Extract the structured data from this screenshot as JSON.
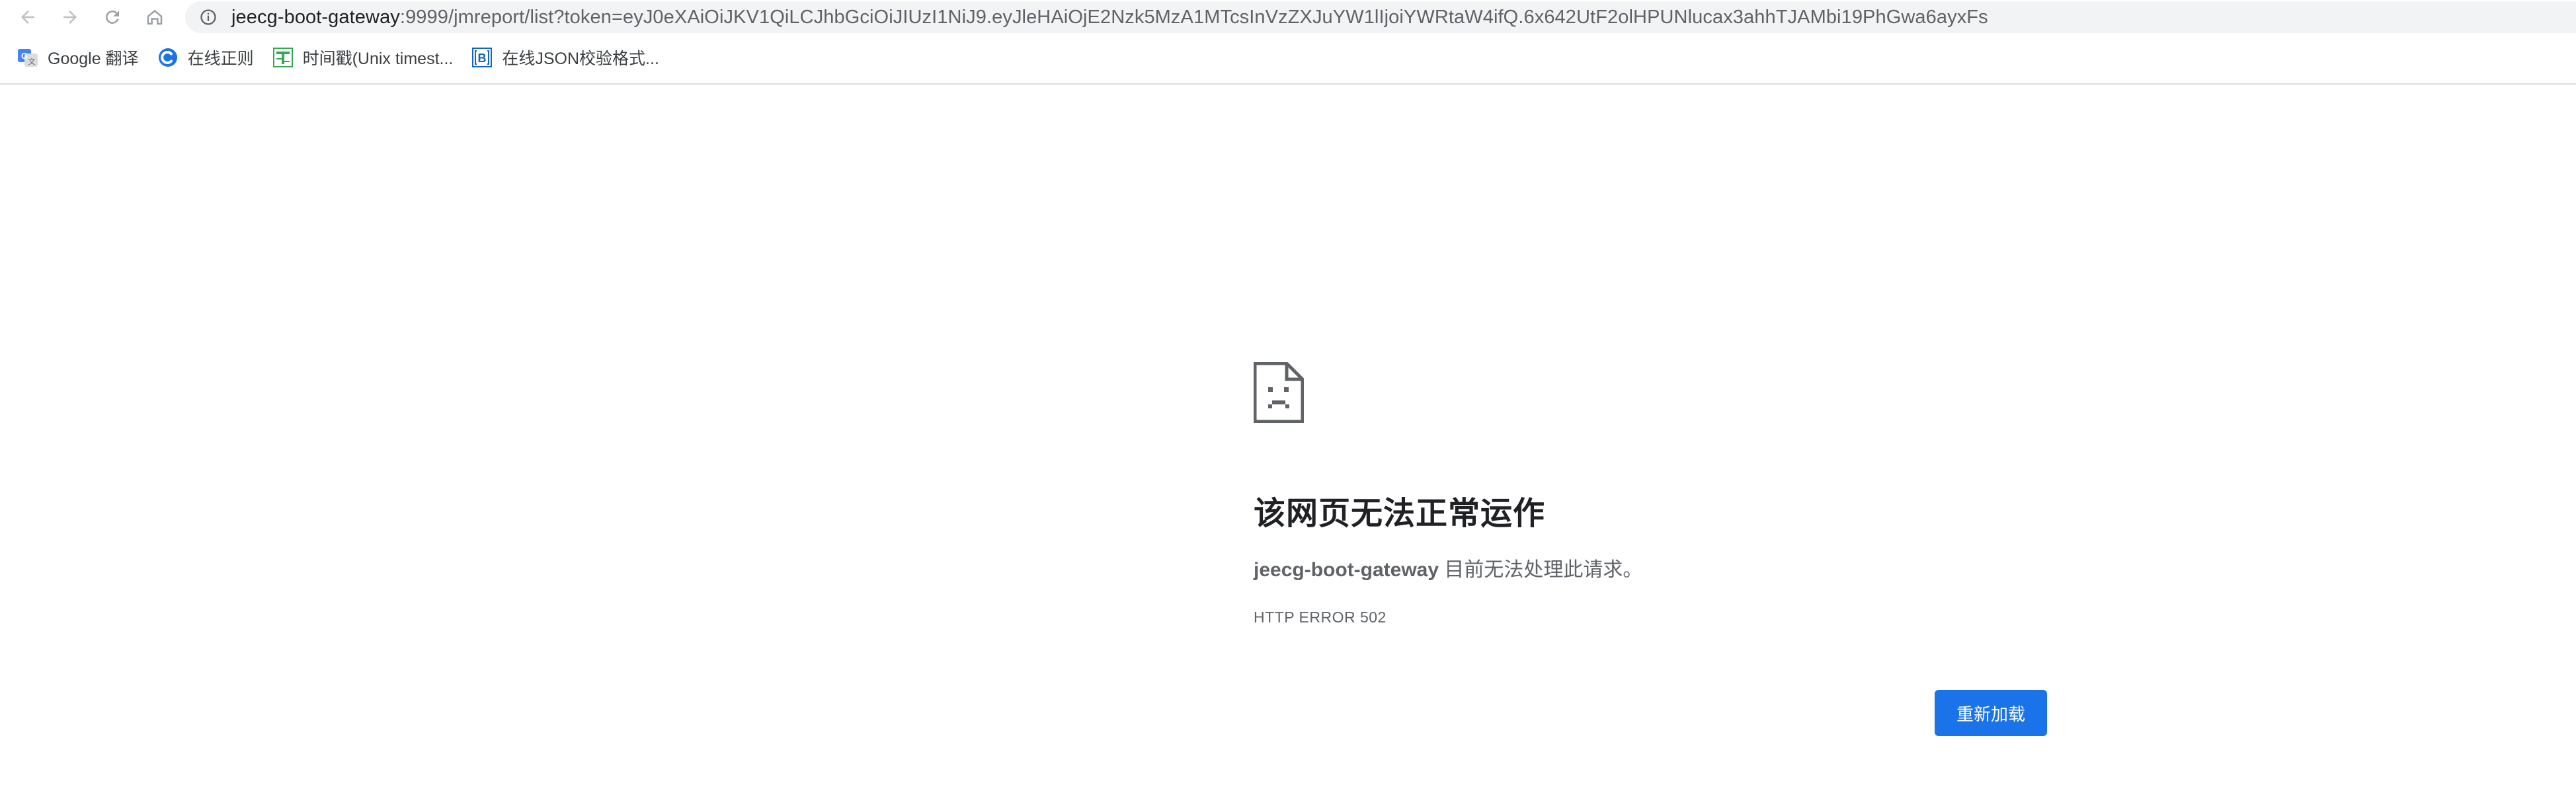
{
  "browser": {
    "url_host": "jeecg-boot-gateway",
    "url_rest": ":9999/jmreport/list?token=eyJ0eXAiOiJKV1QiLCJhbGciOiJIUzI1NiJ9.eyJleHAiOjE2Nzk5MzA1MTcsInVzZXJuYW1lIjoiYWRtaW4ifQ.6x642UtF2olHPUNlucax3ahhTJAMbi19PhGwa6ayxFs",
    "icons": [
      "back-arrow-icon",
      "forward-arrow-icon",
      "reload-icon",
      "home-icon",
      "info-icon"
    ]
  },
  "bookmarks": [
    {
      "label": "Google 翻译",
      "icon": "google-translate-icon",
      "color": "#4285f4"
    },
    {
      "label": "在线正则",
      "icon": "regex-icon",
      "color": "#1a73e8"
    },
    {
      "label": "时间戳(Unix timest...",
      "icon": "timestamp-icon",
      "color": "#34a853"
    },
    {
      "label": "在线JSON校验格式...",
      "icon": "json-icon",
      "color": "#1565c0"
    }
  ],
  "error_page": {
    "icon": "sad-document-icon",
    "title": "该网页无法正常运作",
    "host": "jeecg-boot-gateway",
    "desc": " 目前无法处理此请求。",
    "code": "HTTP ERROR 502",
    "reload_label": "重新加载",
    "accent": "#1a73e8"
  }
}
